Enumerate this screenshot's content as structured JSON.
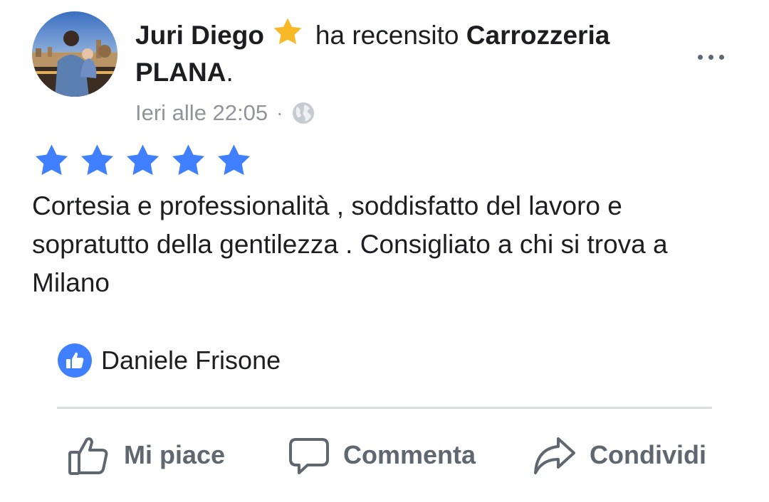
{
  "post": {
    "author": "Juri Diego",
    "action_text": "ha recensito",
    "page_name": "Carrozzeria PLANA",
    "period": ".",
    "timestamp": "Ieri alle 22:05",
    "separator": "·",
    "privacy_icon": "globe-icon",
    "badge_icon": "star-icon",
    "badge_color": "#f7b928"
  },
  "review": {
    "rating": 5,
    "rating_max": 5,
    "star_color": "#4080ff",
    "text": "Cortesia e professionalità , soddisfatto del lavoro e sopratutto della gentilezza . Consigliato a chi si trova a Milano"
  },
  "reactions": {
    "icon": "like-reaction-icon",
    "icon_color": "#4080ff",
    "names": "Daniele Frisone"
  },
  "actions": {
    "like_label": "Mi piace",
    "comment_label": "Commenta",
    "share_label": "Condividi"
  }
}
